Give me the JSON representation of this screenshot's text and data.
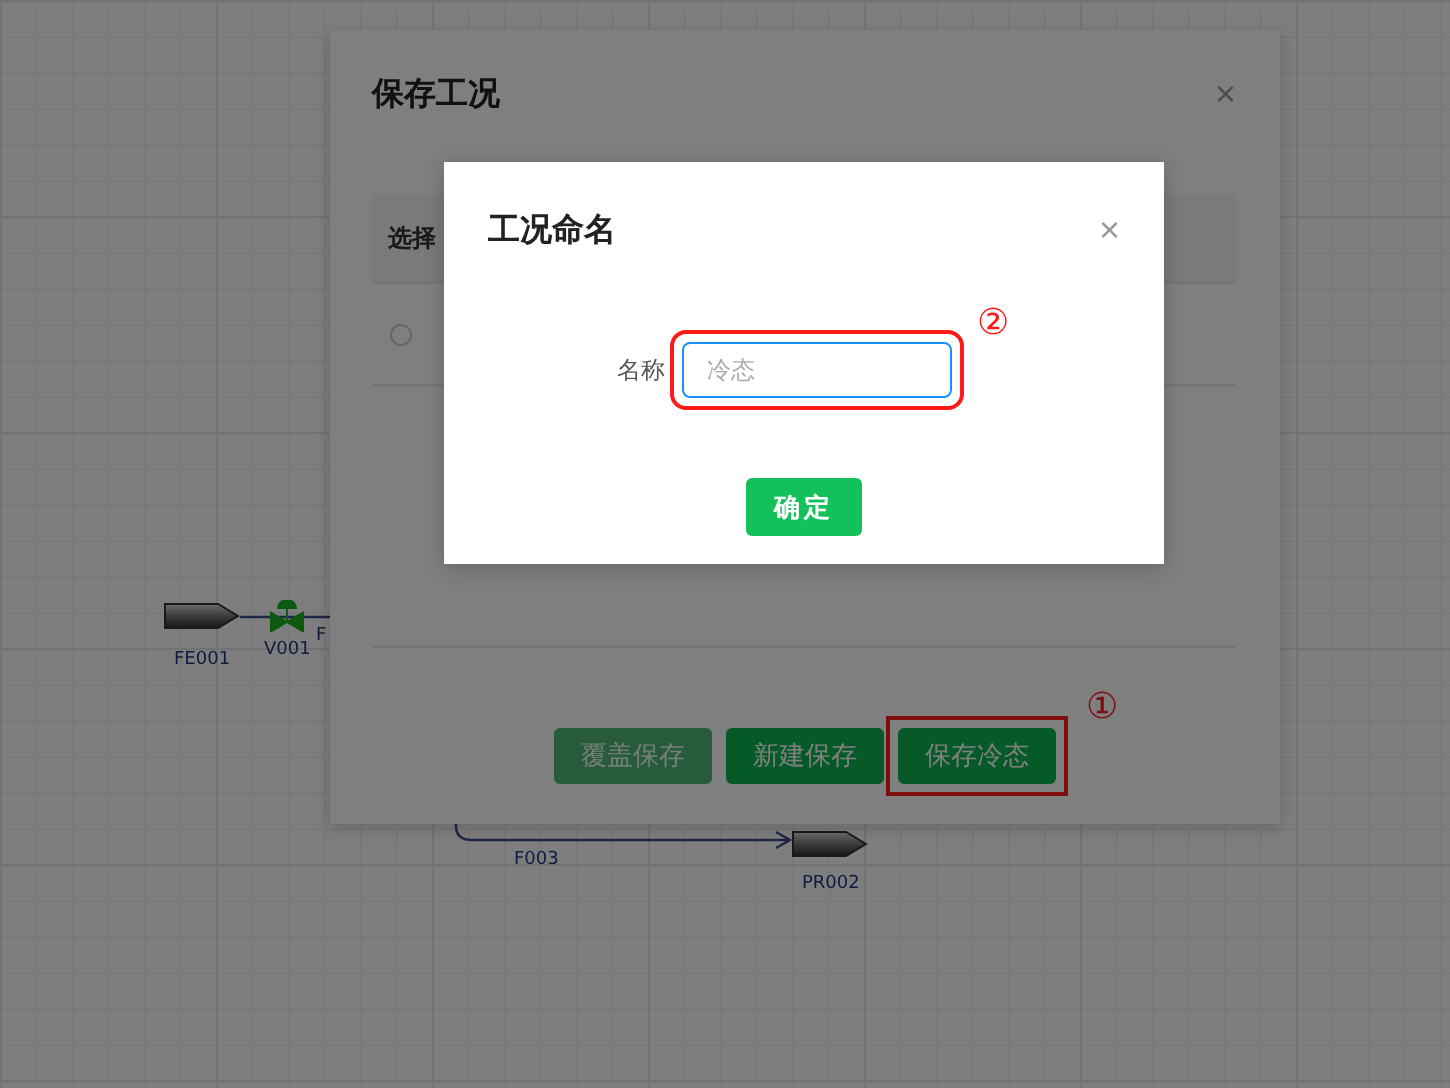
{
  "canvas": {
    "nodes": [
      {
        "kind": "source",
        "label": "FE001"
      },
      {
        "kind": "valve",
        "label": "V001"
      },
      {
        "kind": "sink",
        "label": "PR002"
      }
    ],
    "streams": [
      {
        "label": "F"
      },
      {
        "label": "F003"
      }
    ]
  },
  "save_dialog": {
    "title": "保存工况",
    "close": "×",
    "table": {
      "columns": [
        {
          "label": "选择"
        }
      ],
      "rows": [
        {
          "selected": false
        }
      ]
    },
    "buttons": [
      {
        "label": "覆盖保存",
        "disabled": true
      },
      {
        "label": "新建保存",
        "disabled": false
      },
      {
        "label": "保存冷态",
        "disabled": false,
        "callout": "①"
      }
    ]
  },
  "name_dialog": {
    "title": "工况命名",
    "close": "×",
    "field": {
      "label": "名称",
      "placeholder": "冷态",
      "callout": "②"
    },
    "confirm": "确定"
  }
}
